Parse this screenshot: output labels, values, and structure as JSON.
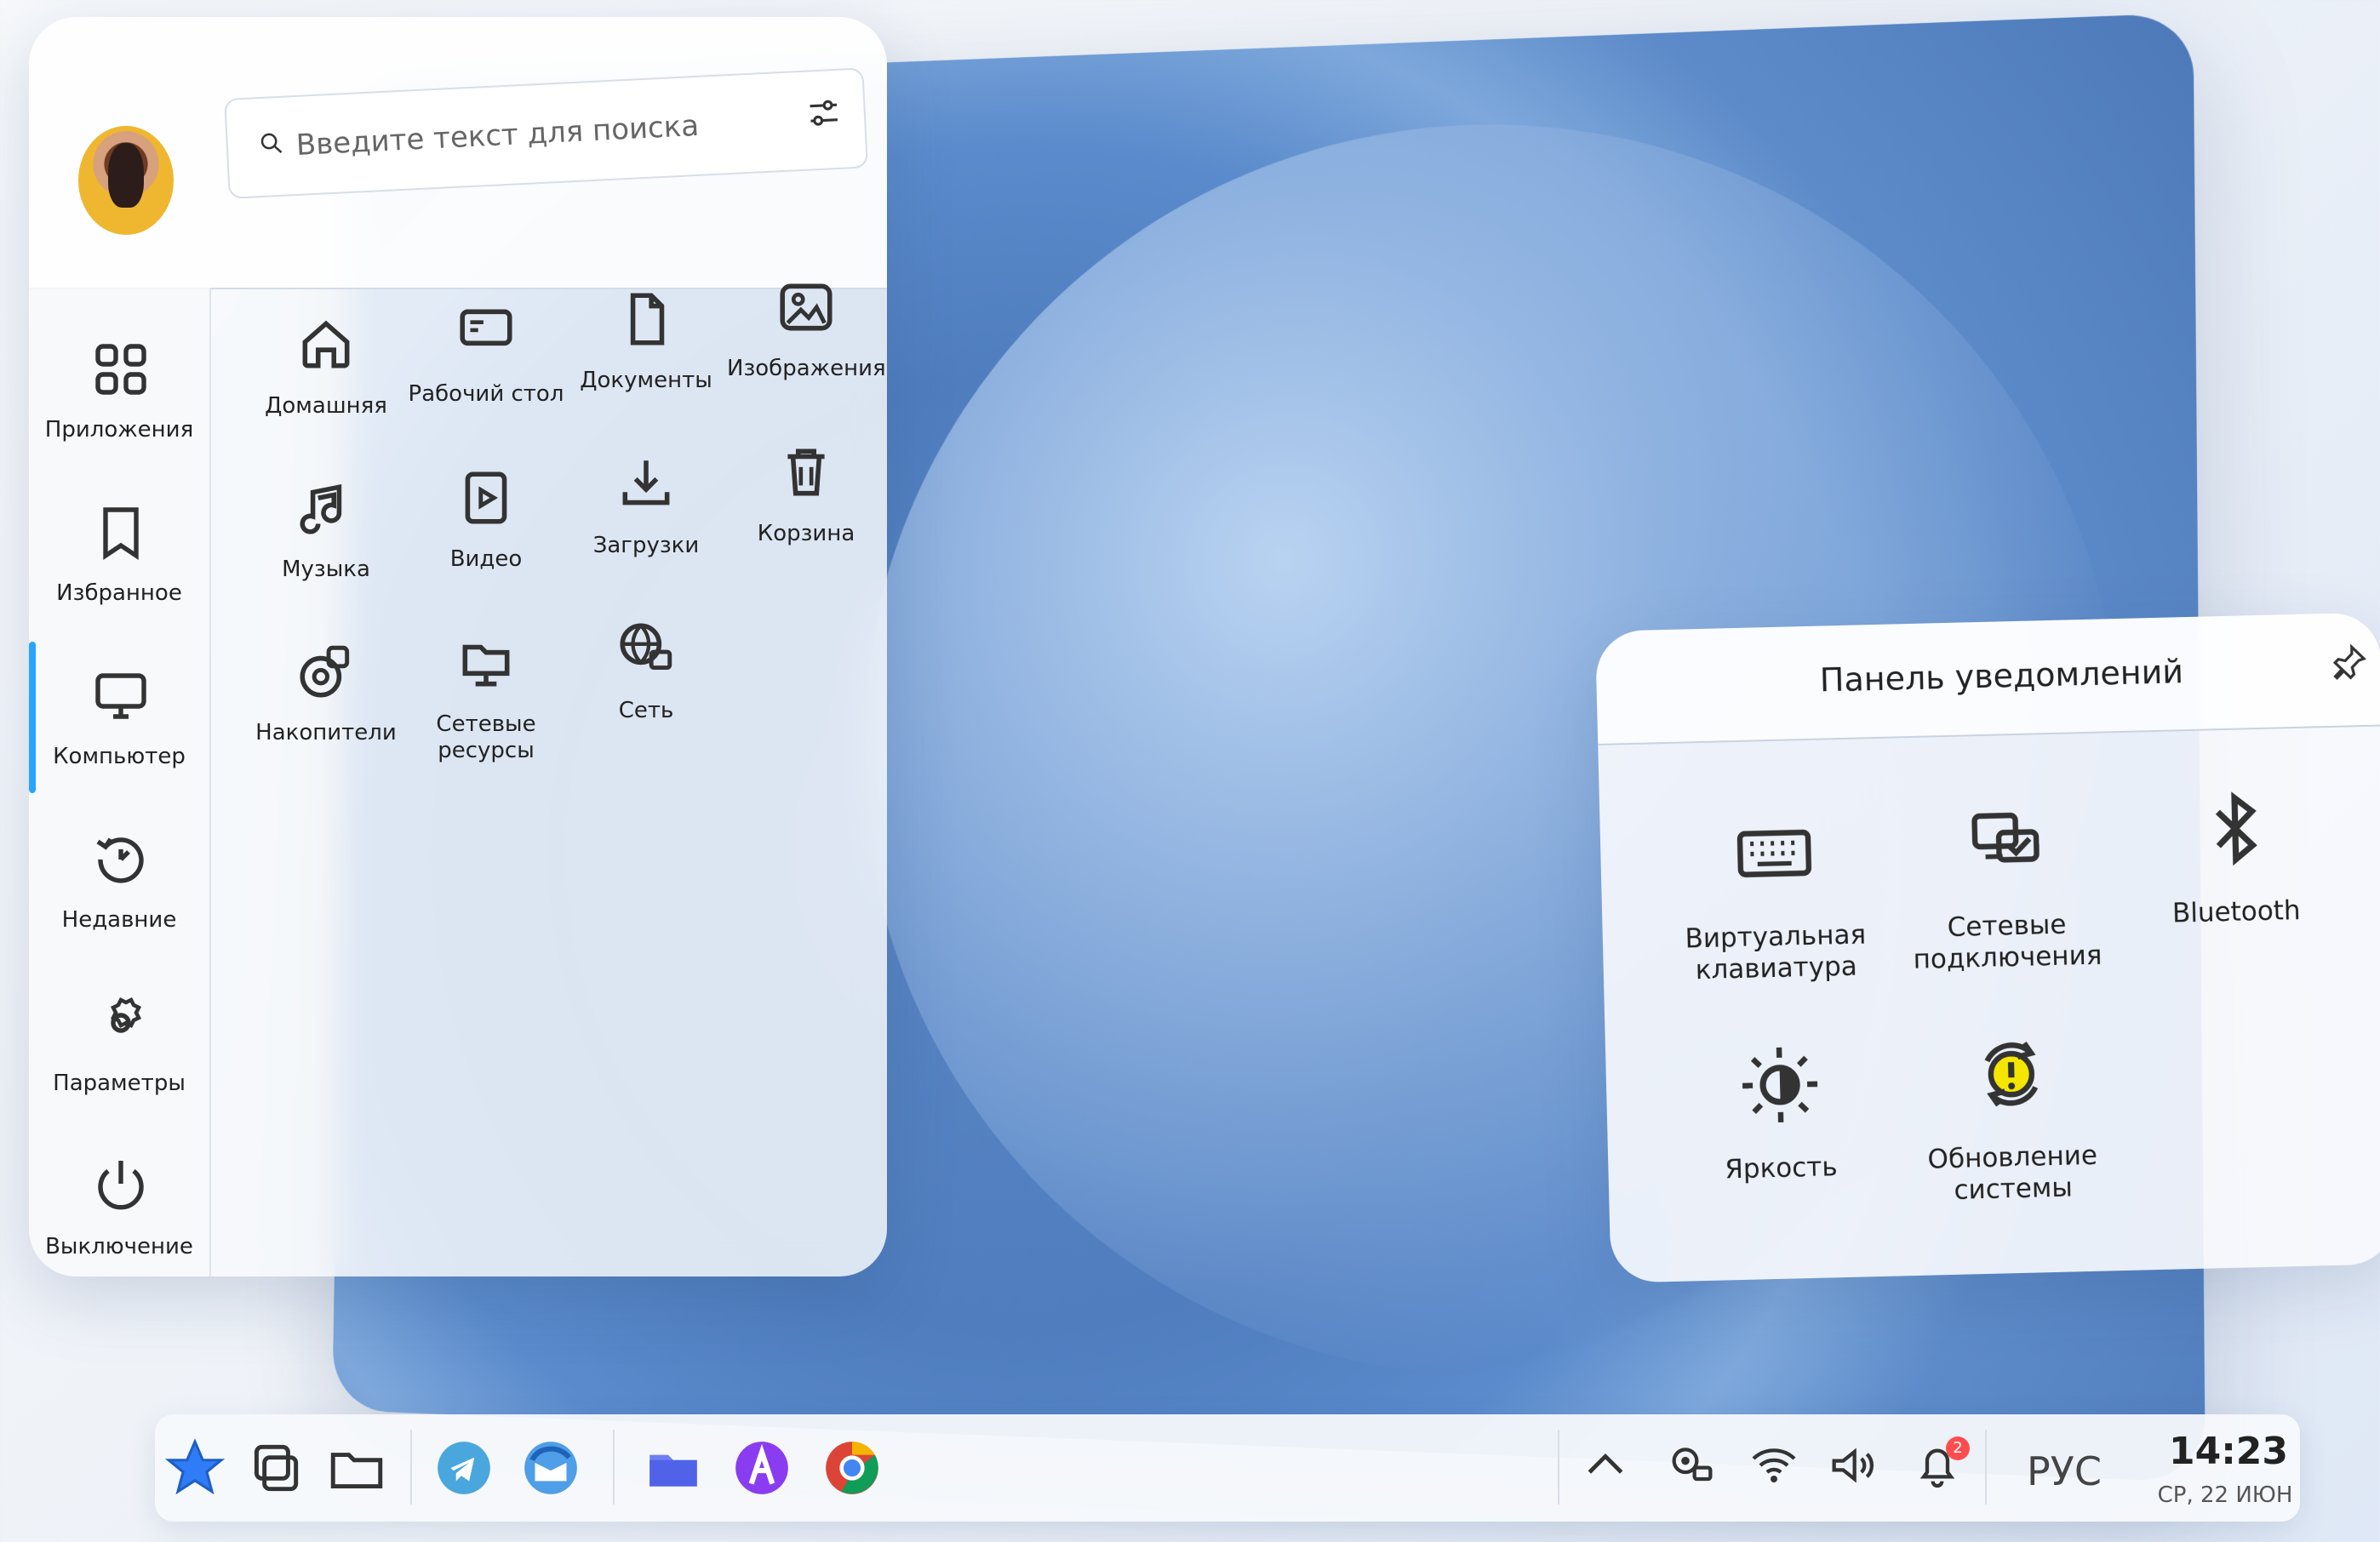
{
  "search": {
    "placeholder": "Введите текст для поиска"
  },
  "sidebar": {
    "items": [
      {
        "label": "Приложения",
        "icon": "apps-icon"
      },
      {
        "label": "Избранное",
        "icon": "bookmark-icon"
      },
      {
        "label": "Компьютер",
        "icon": "computer-icon"
      },
      {
        "label": "Недавние",
        "icon": "recent-icon"
      },
      {
        "label": "Параметры",
        "icon": "settings-icon"
      },
      {
        "label": "Выключение",
        "icon": "power-icon"
      }
    ]
  },
  "grid": {
    "items": [
      {
        "label": "Домашняя",
        "icon": "home-icon"
      },
      {
        "label": "Рабочий стол",
        "icon": "desktop-icon"
      },
      {
        "label": "Документы",
        "icon": "document-icon"
      },
      {
        "label": "Изображения",
        "icon": "image-icon"
      },
      {
        "label": "Музыка",
        "icon": "music-icon"
      },
      {
        "label": "Видео",
        "icon": "video-icon"
      },
      {
        "label": "Загрузки",
        "icon": "download-icon"
      },
      {
        "label": "Корзина",
        "icon": "trash-icon"
      },
      {
        "label": "Накопители",
        "icon": "drives-icon"
      },
      {
        "label": "Сетевые ресурсы",
        "icon": "network-resources-icon"
      },
      {
        "label": "Сеть",
        "icon": "network-icon"
      }
    ]
  },
  "notifications": {
    "title": "Панель уведомлений",
    "items": [
      {
        "label": "Виртуальная клавиатура",
        "icon": "keyboard-icon"
      },
      {
        "label": "Сетевые подключения",
        "icon": "network-connections-icon"
      },
      {
        "label": "Bluetooth",
        "icon": "bluetooth-icon"
      },
      {
        "label": "Яркость",
        "icon": "brightness-icon"
      },
      {
        "label": "Обновление системы",
        "icon": "system-update-icon"
      }
    ]
  },
  "taskbar": {
    "language": "РУС",
    "time": "14:23",
    "date": "СР, 22 ИЮН",
    "notification_count": "2"
  }
}
